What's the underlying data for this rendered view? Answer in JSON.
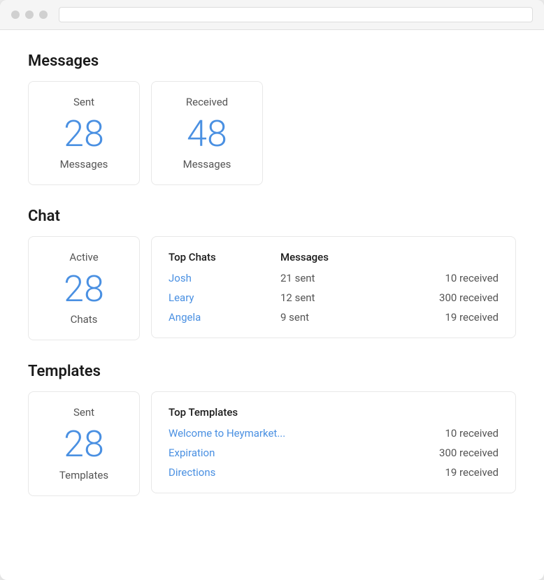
{
  "browser": {
    "url": ""
  },
  "sections": {
    "messages": {
      "title": "Messages",
      "sent_card": {
        "label_top": "Sent",
        "number": "28",
        "label_bottom": "Messages"
      },
      "received_card": {
        "label_top": "Received",
        "number": "48",
        "label_bottom": "Messages"
      }
    },
    "chat": {
      "title": "Chat",
      "active_card": {
        "label_top": "Active",
        "number": "28",
        "label_bottom": "Chats"
      },
      "top_chats": {
        "col_name": "Top Chats",
        "col_messages": "Messages",
        "rows": [
          {
            "name": "Josh",
            "sent": "21 sent",
            "received": "10 received"
          },
          {
            "name": "Leary",
            "sent": "12 sent",
            "received": "300 received"
          },
          {
            "name": "Angela",
            "sent": "9 sent",
            "received": "19 received"
          }
        ]
      }
    },
    "templates": {
      "title": "Templates",
      "sent_card": {
        "label_top": "Sent",
        "number": "28",
        "label_bottom": "Templates"
      },
      "top_templates": {
        "col_name": "Top Templates",
        "rows": [
          {
            "name": "Welcome to Heymarket...",
            "received": "10 received"
          },
          {
            "name": "Expiration",
            "received": "300 received"
          },
          {
            "name": "Directions",
            "received": "19 received"
          }
        ]
      }
    }
  }
}
